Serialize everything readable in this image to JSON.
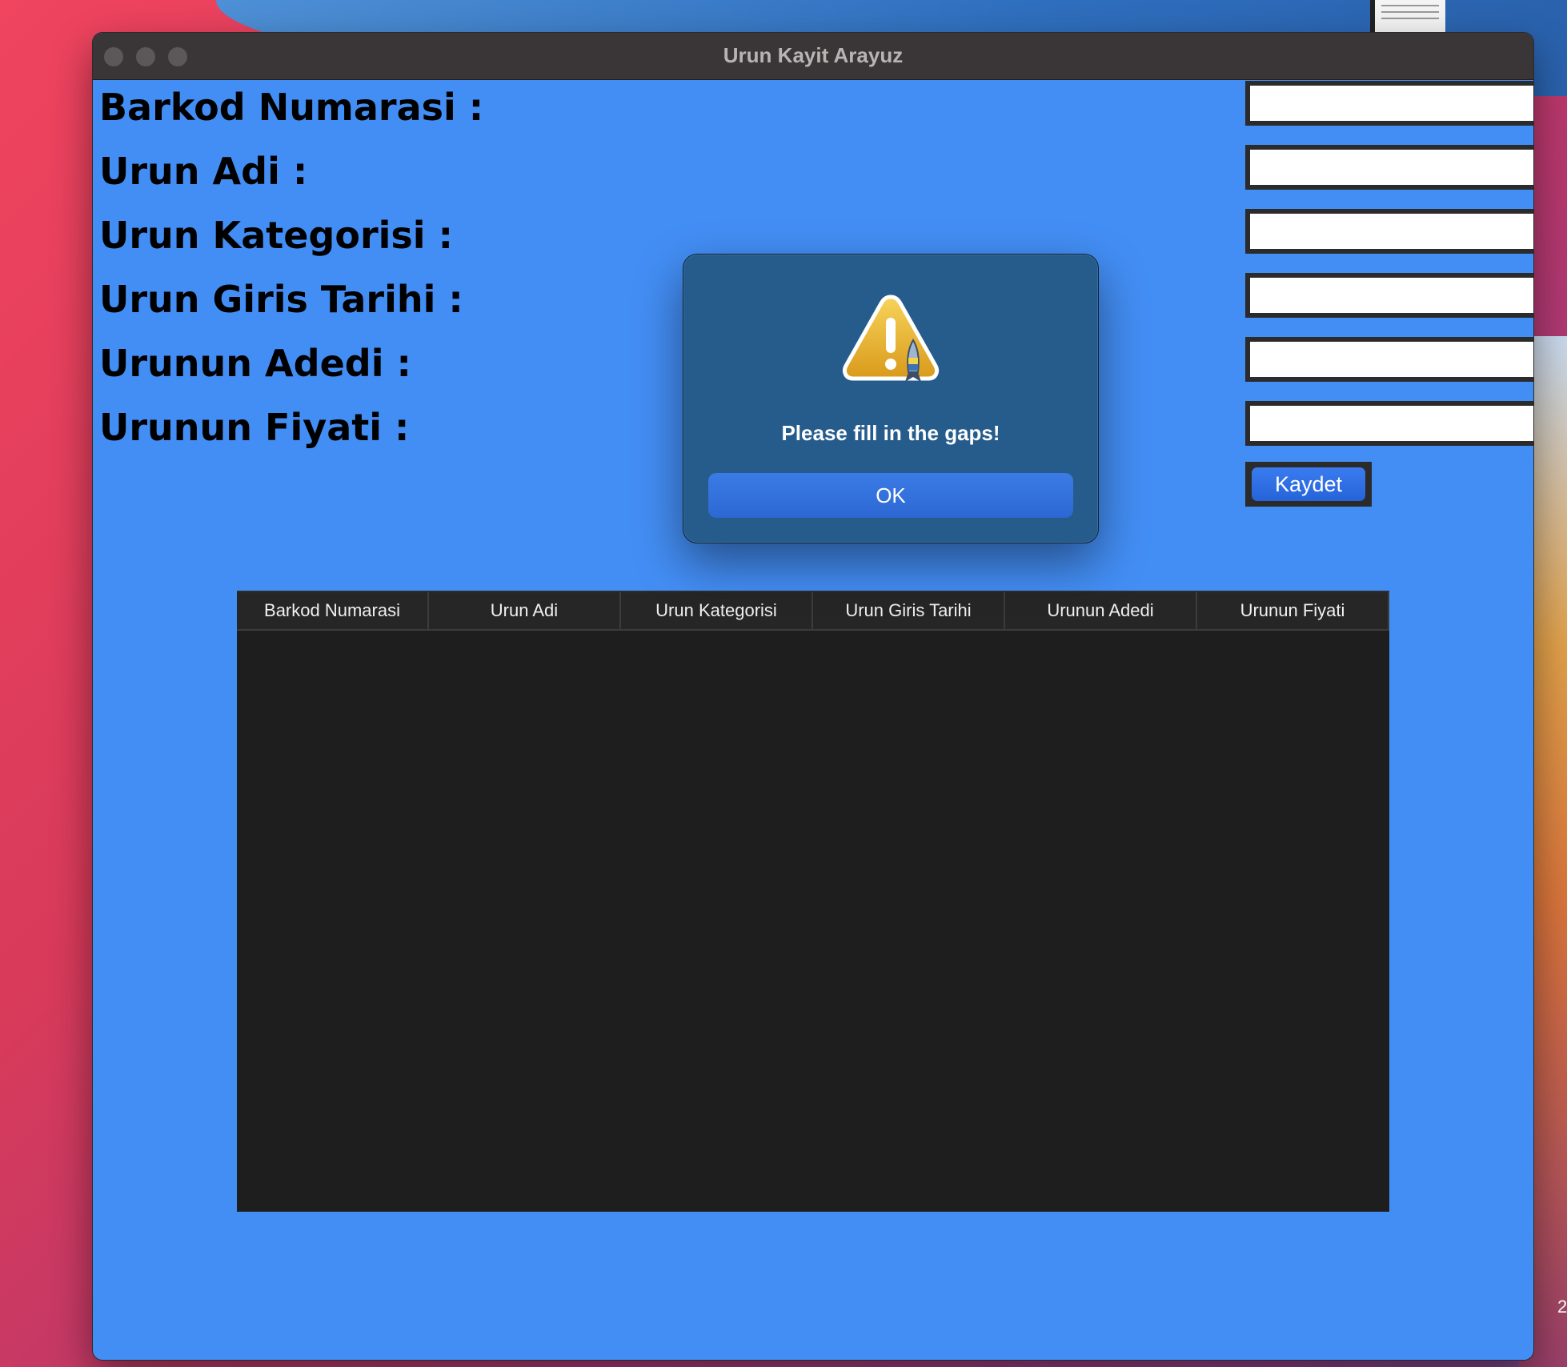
{
  "window": {
    "title": "Urun Kayit Arayuz"
  },
  "form": {
    "labels": [
      "Barkod Numarasi :",
      "Urun Adi :",
      "Urun Kategorisi :",
      "Urun Giris Tarihi :",
      "Urunun Adedi :",
      "Urunun Fiyati :"
    ],
    "values": [
      "",
      "",
      "",
      "",
      "",
      ""
    ],
    "save_label": "Kaydet"
  },
  "table": {
    "columns": [
      "Barkod Numarasi",
      "Urun Adi",
      "Urun Kategorisi",
      "Urun Giris Tarihi",
      "Urunun Adedi",
      "Urunun Fiyati"
    ],
    "rows": []
  },
  "alert": {
    "icon": "warning-icon",
    "message": "Please fill in the gaps!",
    "ok_label": "OK"
  },
  "desktop": {
    "clock_fragment": "2"
  },
  "colors": {
    "window_bg": "#438ef5",
    "dialog_bg": "#265c8c",
    "button_blue": "#2c68d3",
    "table_bg": "#1e1e1e"
  }
}
